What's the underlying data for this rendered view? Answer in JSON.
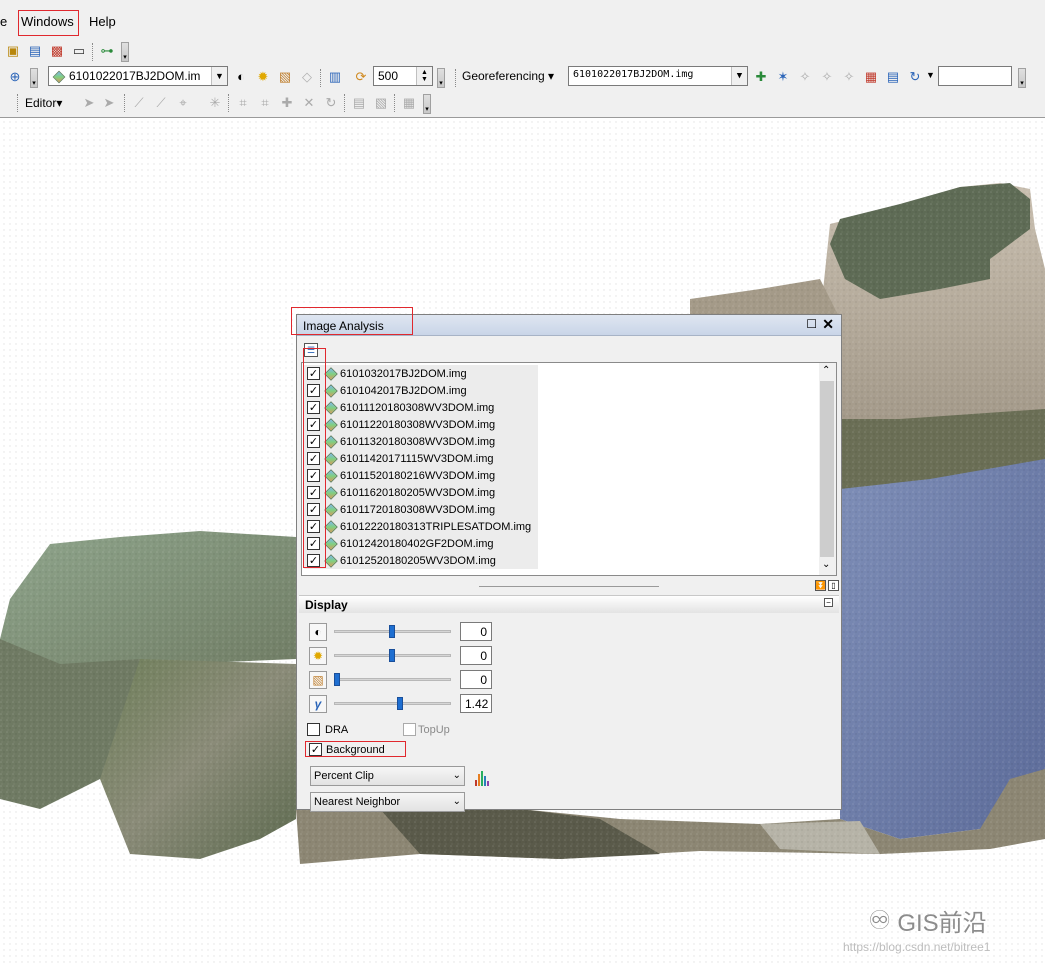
{
  "menu": {
    "partial_item": "e",
    "windows": "Windows",
    "help": "Help"
  },
  "toolbar": {
    "layer_dropdown": "6101022017BJ2DOM.im",
    "scale_value": "500",
    "georef_label": "Georeferencing",
    "georef_layer": "6101022017BJ2DOM.img",
    "editor_label": "Editor"
  },
  "panel": {
    "title": "Image Analysis",
    "layers": [
      "6101032017BJ2DOM.img",
      "6101042017BJ2DOM.img",
      "61011120180308WV3DOM.img",
      "61011220180308WV3DOM.img",
      "61011320180308WV3DOM.img",
      "61011420171115WV3DOM.img",
      "61011520180216WV3DOM.img",
      "61011620180205WV3DOM.img",
      "61011720180308WV3DOM.img",
      "61012220180313TRIPLESATDOM.img",
      "61012420180402GF2DOM.img",
      "61012520180205WV3DOM.img"
    ],
    "display_header": "Display",
    "contrast_value": "0",
    "brightness_value": "0",
    "transparency_value": "0",
    "gamma_value": "1.42",
    "dra_label": "DRA",
    "topup_label": "TopUp",
    "background_label": "Background",
    "stretch_select": "Percent Clip",
    "resample_select": "Nearest Neighbor"
  },
  "watermark": {
    "brand": "GIS前沿",
    "url": "https://blog.csdn.net/bitree1"
  }
}
